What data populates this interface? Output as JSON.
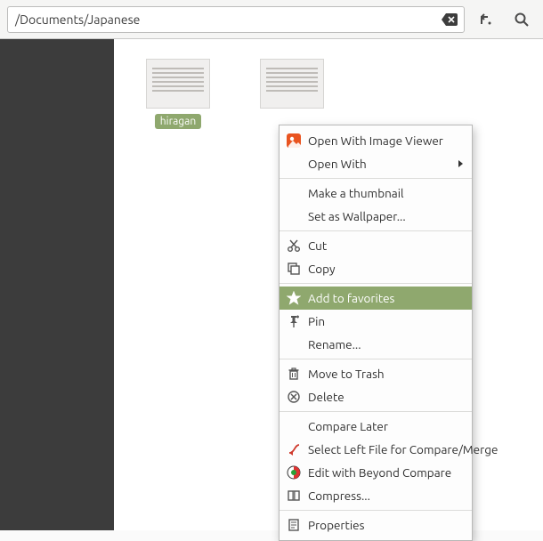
{
  "topbar": {
    "path": "/Documents/Japanese"
  },
  "files": {
    "file1_label": "hiragan",
    "file2_label": ""
  },
  "context_menu": {
    "open_with_image_viewer": "Open With Image Viewer",
    "open_with": "Open With",
    "make_thumbnail": "Make a thumbnail",
    "set_as_wallpaper": "Set as Wallpaper...",
    "cut": "Cut",
    "copy": "Copy",
    "add_to_favorites": "Add to favorites",
    "pin": "Pin",
    "rename": "Rename...",
    "move_to_trash": "Move to Trash",
    "delete": "Delete",
    "compare_later": "Compare Later",
    "select_left_for_compare": "Select Left File for Compare/Merge",
    "edit_with_beyond_compare": "Edit with Beyond Compare",
    "compress": "Compress...",
    "properties": "Properties"
  }
}
